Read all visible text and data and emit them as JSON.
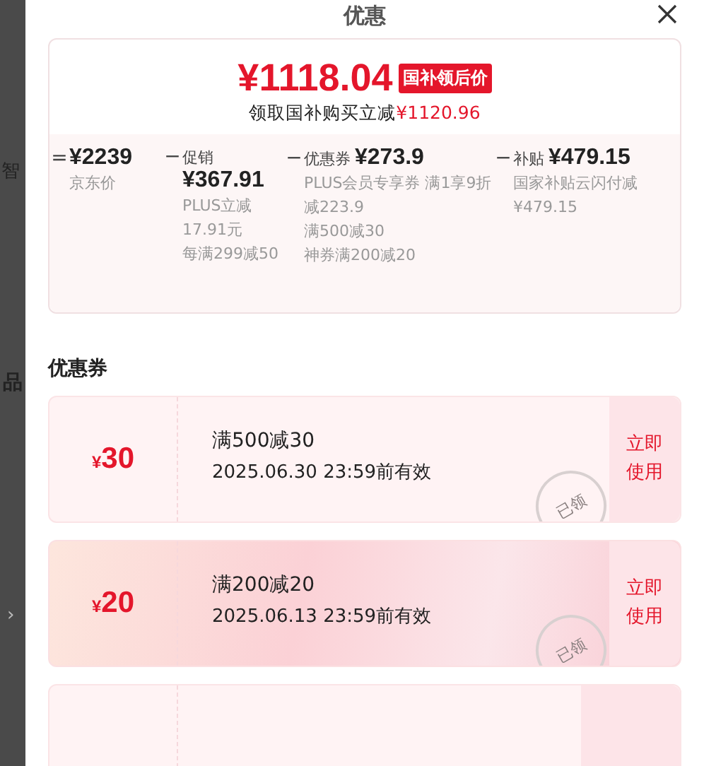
{
  "backdrop": {
    "texts": [
      "智",
      "品",
      "›"
    ]
  },
  "sheet": {
    "title": "优惠"
  },
  "price_card": {
    "price": "¥1118.04",
    "tag": "国补领后价",
    "subtitle_prefix": "领取国补购买立减",
    "subtitle_amount": "¥1120.96",
    "breakdown": [
      {
        "kind": "base",
        "operator": "=",
        "amount": "¥2239",
        "label": "京东价"
      },
      {
        "kind": "deduction",
        "operator": "−",
        "label": "促销",
        "amount": "¥367.91",
        "notes": [
          "PLUS立减17.91元",
          "每满299减50"
        ]
      },
      {
        "kind": "deduction",
        "operator": "−",
        "label": "优惠券",
        "amount": "¥273.9",
        "notes": [
          "PLUS会员专享券 满1享9折减223.9",
          "满500减30",
          "神券满200减20"
        ]
      },
      {
        "kind": "deduction",
        "operator": "−",
        "label": "补贴",
        "amount": "¥479.15",
        "notes": [
          "国家补贴云闪付减¥479.15"
        ]
      }
    ]
  },
  "coupons_section": {
    "heading": "优惠券",
    "coupons": [
      {
        "kind": "full",
        "currency": "¥",
        "value": "30",
        "title": "满500减30",
        "validity": "2025.06.30 23:59前有效",
        "action": "立即使用",
        "claimed": true,
        "stamp": "已领"
      },
      {
        "kind": "full",
        "currency": "¥",
        "value": "20",
        "title": "满200减20",
        "validity": "2025.06.13 23:59前有效",
        "action": "立即使用",
        "claimed": true,
        "stamp": "已领"
      },
      {
        "kind": "partial"
      }
    ]
  }
}
